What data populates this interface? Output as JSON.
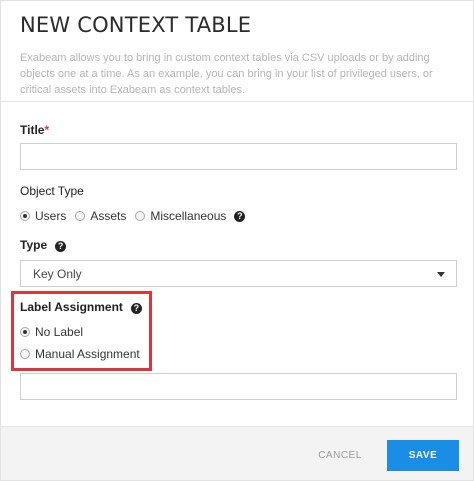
{
  "dialog": {
    "title": "NEW CONTEXT TABLE",
    "description": "Exabeam allows you to bring in custom context tables via CSV uploads or by adding objects one at a time. As an example, you can bring in your list of privileged users, or critical assets into Exabeam as context tables."
  },
  "title_field": {
    "label": "Title",
    "required_marker": "*",
    "value": ""
  },
  "object_type": {
    "label": "Object Type",
    "options": [
      {
        "label": "Users",
        "selected": true
      },
      {
        "label": "Assets",
        "selected": false
      },
      {
        "label": "Miscellaneous",
        "selected": false
      }
    ],
    "help_icon": "question-circle-icon"
  },
  "type_field": {
    "label": "Type",
    "help_icon": "question-circle-icon",
    "selected": "Key Only",
    "caret_icon": "caret-down-icon"
  },
  "label_assignment": {
    "label": "Label Assignment",
    "help_icon": "question-circle-icon",
    "options": [
      {
        "label": "No Label",
        "selected": true
      },
      {
        "label": "Manual Assignment",
        "selected": false
      }
    ],
    "input_value": ""
  },
  "footer": {
    "cancel_label": "CANCEL",
    "save_label": "SAVE"
  },
  "colors": {
    "accent": "#1a8ee6",
    "highlight": "#e0333c",
    "required": "#e03333"
  }
}
